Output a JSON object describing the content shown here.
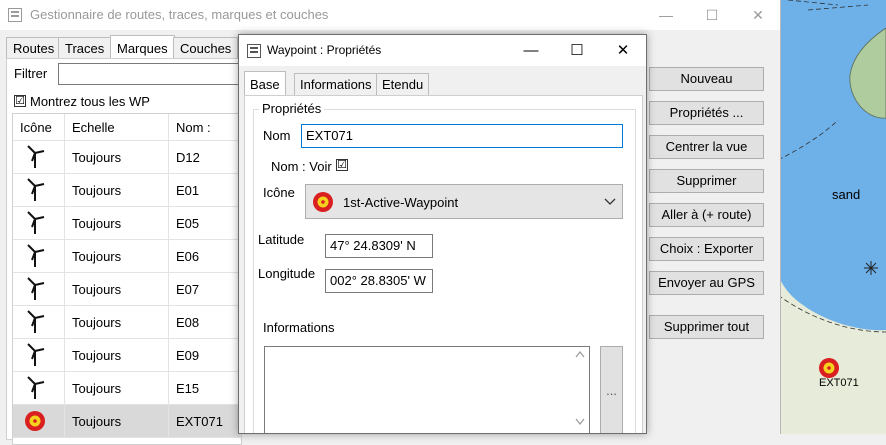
{
  "main_window": {
    "title": "Gestionnaire de routes, traces, marques et couches",
    "tabs": [
      "Routes",
      "Traces",
      "Marques",
      "Couches"
    ],
    "active_tab": 2,
    "filter_label": "Filtrer",
    "filter_value": "",
    "show_all_label": "Montrez tous les WP",
    "show_all_checked": "☑",
    "columns": [
      "Icône",
      "Echelle",
      "Nom :"
    ],
    "rows": [
      {
        "scale": "Toujours",
        "name": "D12",
        "icon": "wind-turbine-icon"
      },
      {
        "scale": "Toujours",
        "name": "E01",
        "icon": "wind-turbine-icon"
      },
      {
        "scale": "Toujours",
        "name": "E05",
        "icon": "wind-turbine-icon"
      },
      {
        "scale": "Toujours",
        "name": "E06",
        "icon": "wind-turbine-icon"
      },
      {
        "scale": "Toujours",
        "name": "E07",
        "icon": "wind-turbine-icon"
      },
      {
        "scale": "Toujours",
        "name": "E08",
        "icon": "wind-turbine-icon"
      },
      {
        "scale": "Toujours",
        "name": "E09",
        "icon": "wind-turbine-icon"
      },
      {
        "scale": "Toujours",
        "name": "E15",
        "icon": "wind-turbine-icon"
      },
      {
        "scale": "Toujours",
        "name": "EXT071",
        "icon": "active-waypoint-icon"
      }
    ],
    "buttons": [
      "Nouveau",
      "Propriétés ...",
      "Centrer la vue",
      "Supprimer",
      "Aller à (+ route)",
      "Choix : Exporter",
      "Envoyer au GPS",
      "Supprimer tout"
    ]
  },
  "dialog": {
    "title": "Waypoint : Propriétés",
    "tabs": [
      "Base",
      "Informations",
      "Etendu"
    ],
    "group_title": "Propriétés",
    "name_label": "Nom",
    "name_value": "EXT071",
    "show_name_label": "Nom : Voir",
    "show_name_checked": "☑",
    "icon_label": "Icône",
    "icon_value": "1st-Active-Waypoint",
    "latitude_label": "Latitude",
    "latitude_value": "47° 24.8309' N",
    "longitude_label": "Longitude",
    "longitude_value": "002° 28.8305' W",
    "info_label": "Informations",
    "info_value": "",
    "ellipsis_label": "..."
  },
  "map": {
    "sand_label": "sand",
    "waypoint_label": "EXT071"
  },
  "colors": {
    "water": "#6eb0e8",
    "land": "#e6ecd9",
    "waypoint_red": "#d91f1f",
    "waypoint_yellow": "#f4d21e"
  }
}
